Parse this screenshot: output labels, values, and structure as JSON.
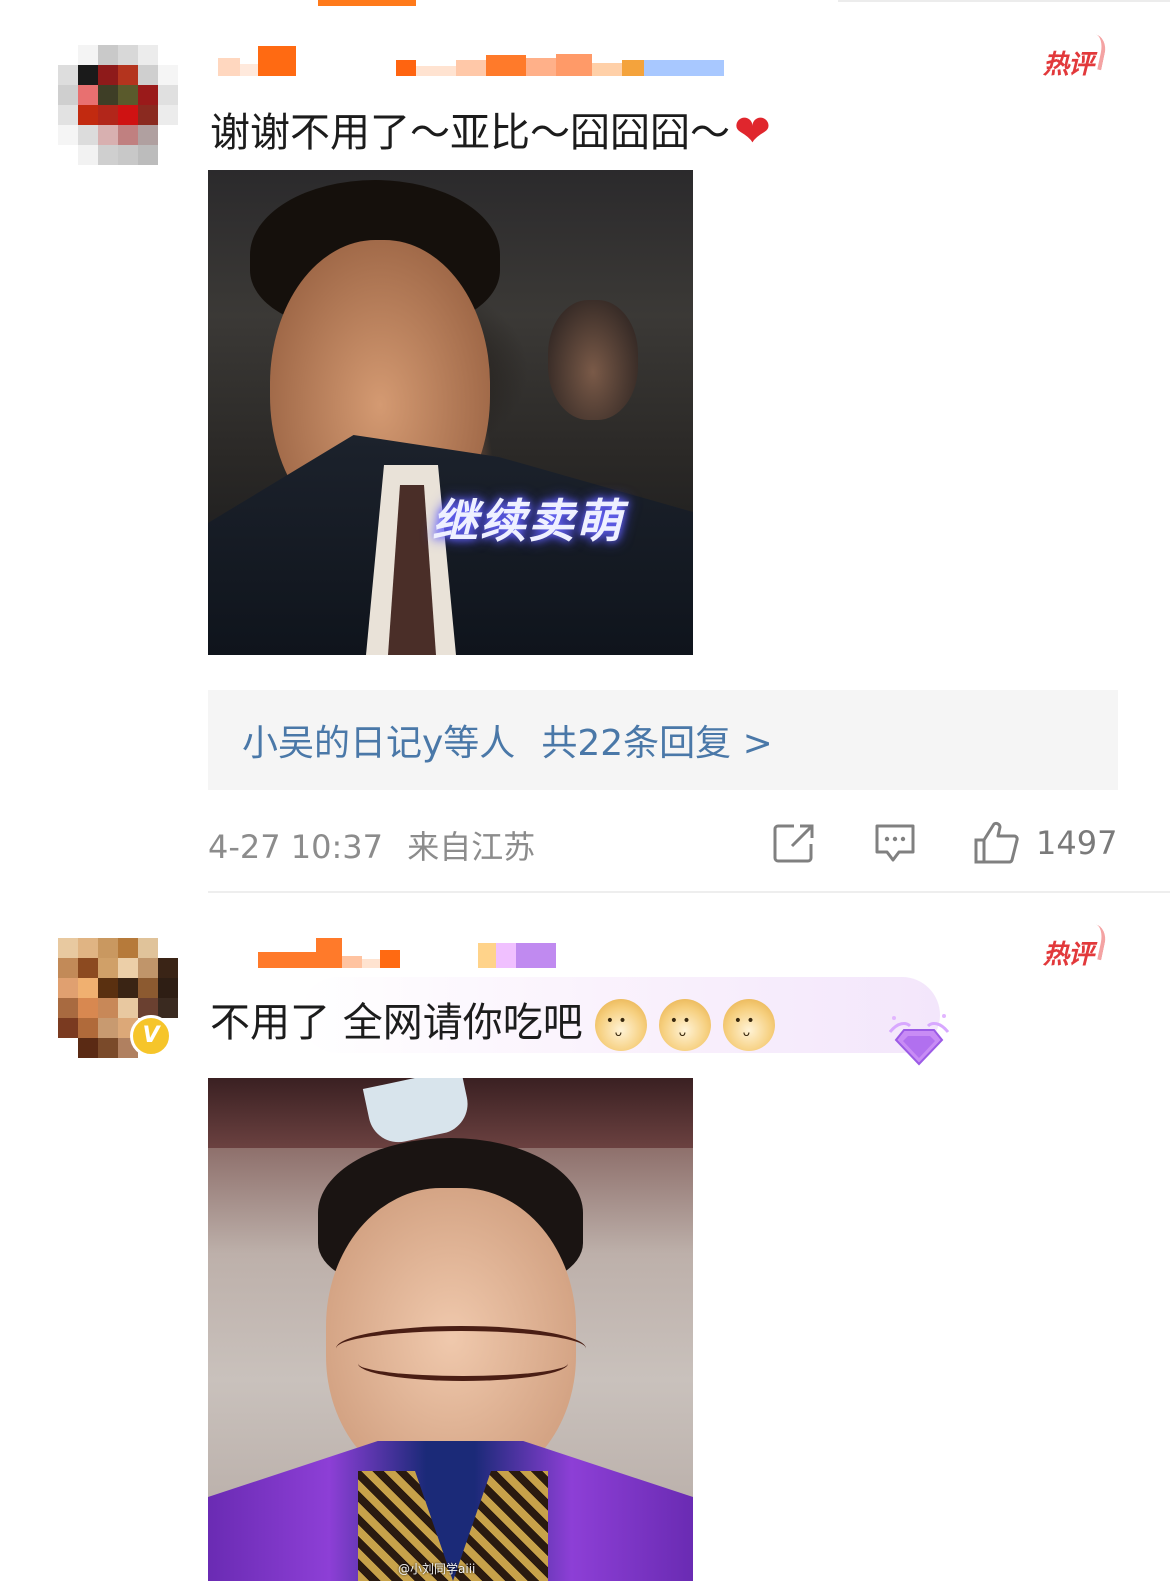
{
  "badges": {
    "hot": "热评"
  },
  "comments": [
    {
      "text": "谢谢不用了～亚比～囧囧囧～",
      "emoji": "❤",
      "image_caption": "继续卖萌",
      "replies": {
        "who": "小吴的日记y等人",
        "total": "共22条回复 >"
      },
      "timestamp": "4-27 10:37",
      "location": "来自江苏",
      "likes": "1497"
    },
    {
      "text": "不用了 全网请你吃吧",
      "verified_badge": "V",
      "image_watermark": "@小刘同学aiii"
    }
  ],
  "icons": [
    "share-icon",
    "comment-icon",
    "like-icon",
    "gem-badge-icon",
    "doge-emoji-icon"
  ],
  "colors": {
    "hot": "#e2393b",
    "link": "#4a78a8",
    "meta": "#8c8c8c",
    "heart": "#e0262d",
    "accent": "#ff7a1a"
  }
}
